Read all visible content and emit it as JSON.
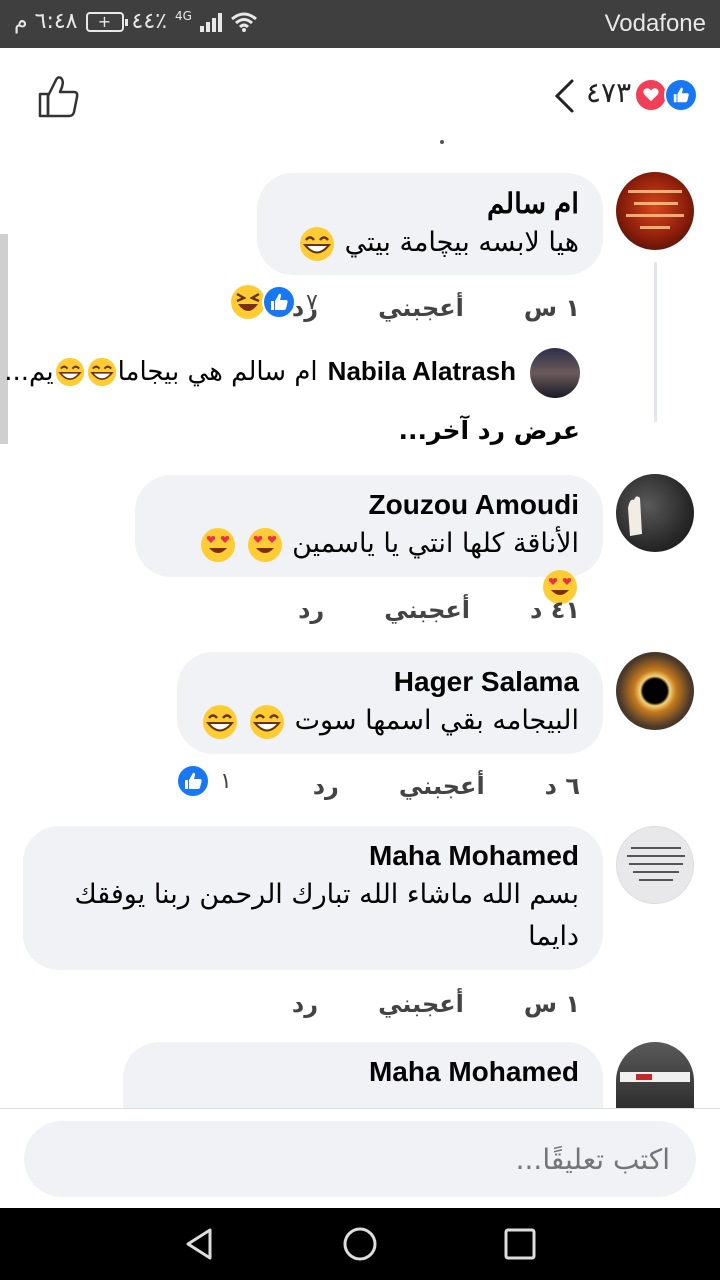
{
  "status_bar": {
    "carrier": "Vodafone",
    "time": "٦:٤٨ م",
    "battery": "٤٤٪",
    "network": "4G"
  },
  "header": {
    "reaction_count": "٤٧٣"
  },
  "comments": [
    {
      "name": "ام سالم",
      "text": "هيا لابسه بيچامة بيتي",
      "time": "١ س",
      "like_label": "أعجبني",
      "reply_label": "رد",
      "reaction_count": "٧",
      "reply_preview": {
        "name": "Nabila Alatrash",
        "text": "ام سالم هي بيجاما",
        "suffix": "يم..."
      },
      "more_replies": "عرض رد آخر..."
    },
    {
      "name": "Zouzou Amoudi",
      "text": "الأناقة كلها انتي يا ياسمين",
      "time": "٤١ د",
      "like_label": "أعجبني",
      "reply_label": "رد"
    },
    {
      "name": "Hager Salama",
      "text": "البيجامه بقي اسمها سوت",
      "time": "٦ د",
      "like_label": "أعجبني",
      "reply_label": "رد",
      "reaction_count": "١"
    },
    {
      "name": "Maha Mohamed",
      "text": "بسم الله ماشاء الله تبارك الرحمن ربنا يوفقك دايما",
      "time": "١ س",
      "like_label": "أعجبني",
      "reply_label": "رد"
    },
    {
      "name": "Maha Mohamed"
    }
  ],
  "composer": {
    "placeholder": "اكتب تعليقًا..."
  },
  "colors": {
    "like_blue": "#1877f2",
    "love_red": "#f33e58",
    "bubble_bg": "#f0f2f5"
  },
  "icons": [
    "like-outline-icon",
    "back-chevron-icon",
    "laugh-emoji-icon",
    "heart-eyes-emoji-icon",
    "nav-back-icon",
    "nav-home-icon",
    "nav-recents-icon"
  ]
}
